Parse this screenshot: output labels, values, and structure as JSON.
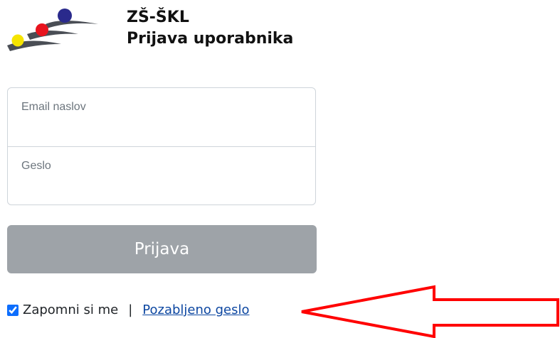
{
  "header": {
    "app_title": "ZŠ-ŠKL",
    "page_title": "Prijava uporabnika"
  },
  "form": {
    "email_label": "Email naslov",
    "email_value": "",
    "password_label": "Geslo",
    "password_value": ""
  },
  "login_button_label": "Prijava",
  "remember": {
    "label": "Zapomni si me",
    "checked": true,
    "separator": "|",
    "forgot_link": "Pozabljeno geslo"
  },
  "colors": {
    "button_disabled": "#9ea3a8",
    "link": "#0d47a1",
    "arrow": "#ff0000",
    "logo_navy": "#2a2a8c",
    "logo_red": "#e8141e",
    "logo_yellow": "#f5e400",
    "logo_gray": "#4a4e55"
  },
  "icons": [
    "logo-icon",
    "checkbox-icon",
    "red-arrow-annotation"
  ]
}
